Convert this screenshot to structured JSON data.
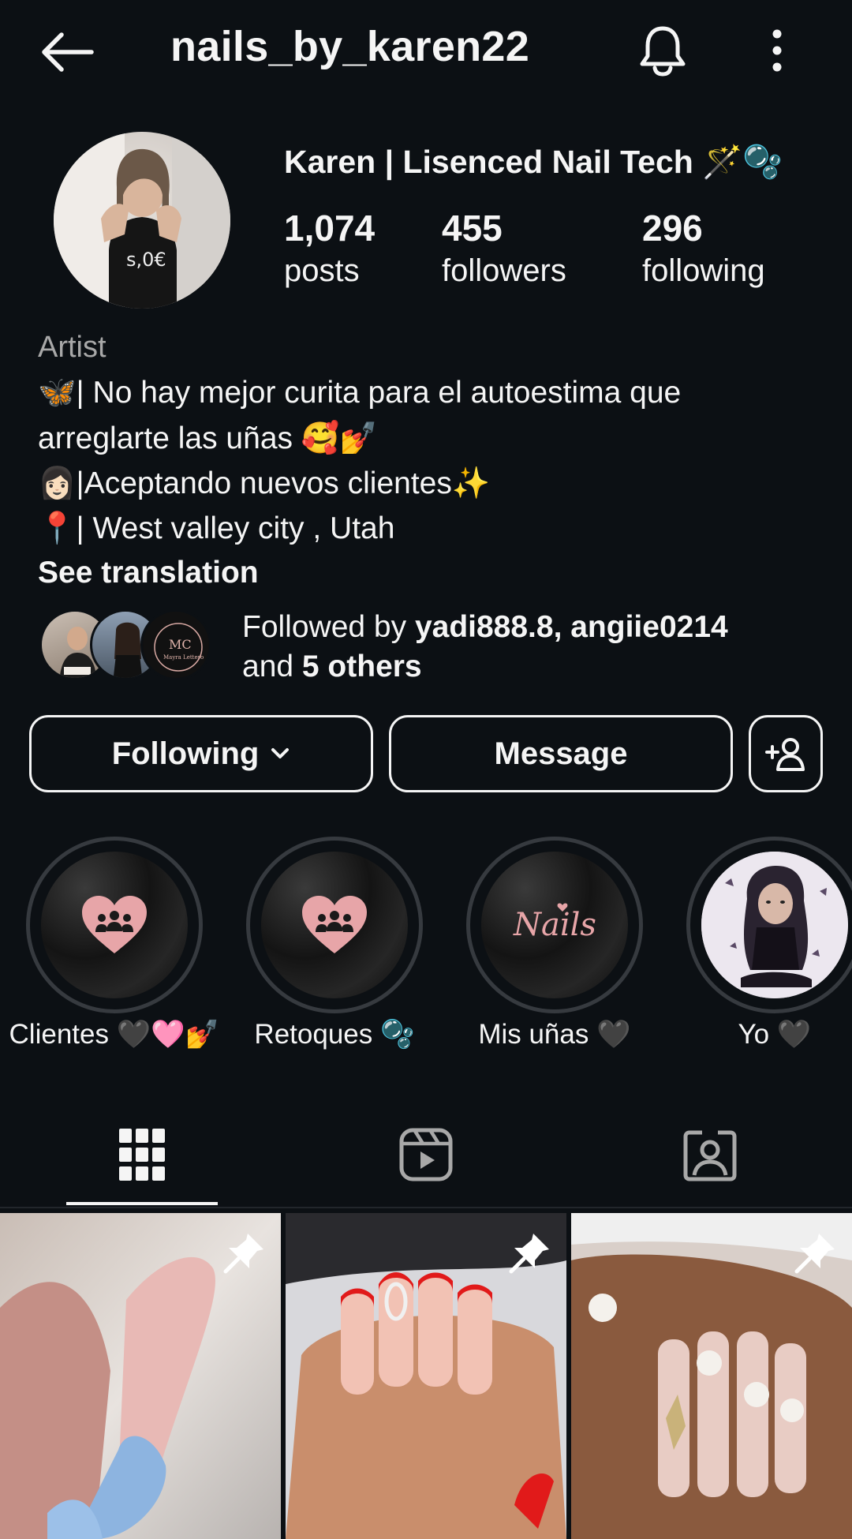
{
  "topbar": {
    "username": "nails_by_karen22",
    "back_icon": "arrow-left-icon",
    "bell_icon": "bell-icon",
    "more_icon": "more-vertical-icon"
  },
  "profile": {
    "display_name": "Karen | Lisenced Nail Tech 🪄🫧",
    "posts_count": "1,074",
    "posts_label": "posts",
    "followers_count": "455",
    "followers_label": "followers",
    "following_count": "296",
    "following_label": "following"
  },
  "bio": {
    "category": "Artist",
    "lines": [
      "🦋| No hay mejor curita para el autoestima que",
      "arreglarte las uñas 🥰💅",
      "👩🏻|Aceptando nuevos clientes✨",
      "📍|  West valley city , Utah"
    ],
    "see_translation": "See translation"
  },
  "followed_by": {
    "prefix": "Followed by ",
    "names": "yadi888.8, angiie0214",
    "and_text": "and ",
    "others": "5 others"
  },
  "actions": {
    "following_label": "Following",
    "message_label": "Message",
    "add_person_icon": "add-person-icon"
  },
  "highlights": [
    {
      "label": "Clientes 🖤🩷💅",
      "icon": "heart-people-icon"
    },
    {
      "label": "Retoques 🫧",
      "icon": "heart-people-icon"
    },
    {
      "label": "Mis uñas 🖤",
      "icon": "nails-script-icon",
      "text": "Nails"
    },
    {
      "label": "Yo 🖤",
      "icon": "doll-image"
    }
  ],
  "tabs": [
    {
      "name": "grid",
      "icon": "grid-icon",
      "active": true
    },
    {
      "name": "reels",
      "icon": "reels-icon",
      "active": false
    },
    {
      "name": "tagged",
      "icon": "tagged-icon",
      "active": false
    }
  ],
  "posts": [
    {
      "pinned": true,
      "subject": "blue-nail-closeup"
    },
    {
      "pinned": true,
      "subject": "red-french-tips"
    },
    {
      "pinned": true,
      "subject": "white-flower-nails"
    }
  ],
  "colors": {
    "background": "#0c1014",
    "text": "#f5f5f5",
    "secondary_text": "#a8a8a8",
    "highlight_ring": "#363a3f",
    "heart_pink": "#e7a5a8"
  }
}
